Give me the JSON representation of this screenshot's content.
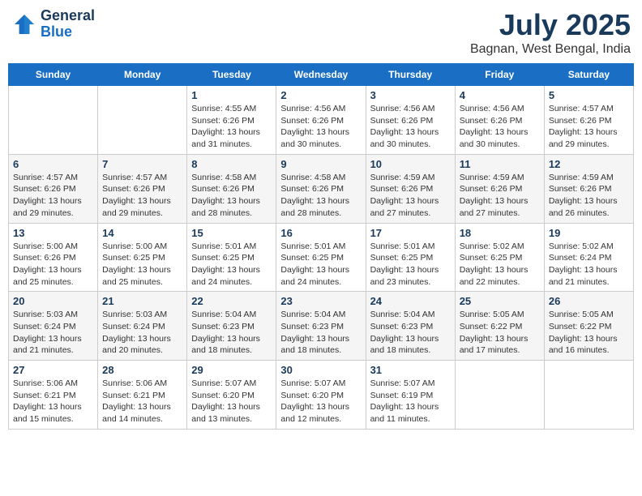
{
  "header": {
    "logo_line1": "General",
    "logo_line2": "Blue",
    "title": "July 2025",
    "subtitle": "Bagnan, West Bengal, India"
  },
  "days_of_week": [
    "Sunday",
    "Monday",
    "Tuesday",
    "Wednesday",
    "Thursday",
    "Friday",
    "Saturday"
  ],
  "weeks": [
    [
      {
        "day": "",
        "info": ""
      },
      {
        "day": "",
        "info": ""
      },
      {
        "day": "1",
        "info": "Sunrise: 4:55 AM\nSunset: 6:26 PM\nDaylight: 13 hours and 31 minutes."
      },
      {
        "day": "2",
        "info": "Sunrise: 4:56 AM\nSunset: 6:26 PM\nDaylight: 13 hours and 30 minutes."
      },
      {
        "day": "3",
        "info": "Sunrise: 4:56 AM\nSunset: 6:26 PM\nDaylight: 13 hours and 30 minutes."
      },
      {
        "day": "4",
        "info": "Sunrise: 4:56 AM\nSunset: 6:26 PM\nDaylight: 13 hours and 30 minutes."
      },
      {
        "day": "5",
        "info": "Sunrise: 4:57 AM\nSunset: 6:26 PM\nDaylight: 13 hours and 29 minutes."
      }
    ],
    [
      {
        "day": "6",
        "info": "Sunrise: 4:57 AM\nSunset: 6:26 PM\nDaylight: 13 hours and 29 minutes."
      },
      {
        "day": "7",
        "info": "Sunrise: 4:57 AM\nSunset: 6:26 PM\nDaylight: 13 hours and 29 minutes."
      },
      {
        "day": "8",
        "info": "Sunrise: 4:58 AM\nSunset: 6:26 PM\nDaylight: 13 hours and 28 minutes."
      },
      {
        "day": "9",
        "info": "Sunrise: 4:58 AM\nSunset: 6:26 PM\nDaylight: 13 hours and 28 minutes."
      },
      {
        "day": "10",
        "info": "Sunrise: 4:59 AM\nSunset: 6:26 PM\nDaylight: 13 hours and 27 minutes."
      },
      {
        "day": "11",
        "info": "Sunrise: 4:59 AM\nSunset: 6:26 PM\nDaylight: 13 hours and 27 minutes."
      },
      {
        "day": "12",
        "info": "Sunrise: 4:59 AM\nSunset: 6:26 PM\nDaylight: 13 hours and 26 minutes."
      }
    ],
    [
      {
        "day": "13",
        "info": "Sunrise: 5:00 AM\nSunset: 6:26 PM\nDaylight: 13 hours and 25 minutes."
      },
      {
        "day": "14",
        "info": "Sunrise: 5:00 AM\nSunset: 6:25 PM\nDaylight: 13 hours and 25 minutes."
      },
      {
        "day": "15",
        "info": "Sunrise: 5:01 AM\nSunset: 6:25 PM\nDaylight: 13 hours and 24 minutes."
      },
      {
        "day": "16",
        "info": "Sunrise: 5:01 AM\nSunset: 6:25 PM\nDaylight: 13 hours and 24 minutes."
      },
      {
        "day": "17",
        "info": "Sunrise: 5:01 AM\nSunset: 6:25 PM\nDaylight: 13 hours and 23 minutes."
      },
      {
        "day": "18",
        "info": "Sunrise: 5:02 AM\nSunset: 6:25 PM\nDaylight: 13 hours and 22 minutes."
      },
      {
        "day": "19",
        "info": "Sunrise: 5:02 AM\nSunset: 6:24 PM\nDaylight: 13 hours and 21 minutes."
      }
    ],
    [
      {
        "day": "20",
        "info": "Sunrise: 5:03 AM\nSunset: 6:24 PM\nDaylight: 13 hours and 21 minutes."
      },
      {
        "day": "21",
        "info": "Sunrise: 5:03 AM\nSunset: 6:24 PM\nDaylight: 13 hours and 20 minutes."
      },
      {
        "day": "22",
        "info": "Sunrise: 5:04 AM\nSunset: 6:23 PM\nDaylight: 13 hours and 18 minutes."
      },
      {
        "day": "23",
        "info": "Sunrise: 5:04 AM\nSunset: 6:23 PM\nDaylight: 13 hours and 18 minutes."
      },
      {
        "day": "24",
        "info": "Sunrise: 5:04 AM\nSunset: 6:23 PM\nDaylight: 13 hours and 18 minutes."
      },
      {
        "day": "25",
        "info": "Sunrise: 5:05 AM\nSunset: 6:22 PM\nDaylight: 13 hours and 17 minutes."
      },
      {
        "day": "26",
        "info": "Sunrise: 5:05 AM\nSunset: 6:22 PM\nDaylight: 13 hours and 16 minutes."
      }
    ],
    [
      {
        "day": "27",
        "info": "Sunrise: 5:06 AM\nSunset: 6:21 PM\nDaylight: 13 hours and 15 minutes."
      },
      {
        "day": "28",
        "info": "Sunrise: 5:06 AM\nSunset: 6:21 PM\nDaylight: 13 hours and 14 minutes."
      },
      {
        "day": "29",
        "info": "Sunrise: 5:07 AM\nSunset: 6:20 PM\nDaylight: 13 hours and 13 minutes."
      },
      {
        "day": "30",
        "info": "Sunrise: 5:07 AM\nSunset: 6:20 PM\nDaylight: 13 hours and 12 minutes."
      },
      {
        "day": "31",
        "info": "Sunrise: 5:07 AM\nSunset: 6:19 PM\nDaylight: 13 hours and 11 minutes."
      },
      {
        "day": "",
        "info": ""
      },
      {
        "day": "",
        "info": ""
      }
    ]
  ]
}
